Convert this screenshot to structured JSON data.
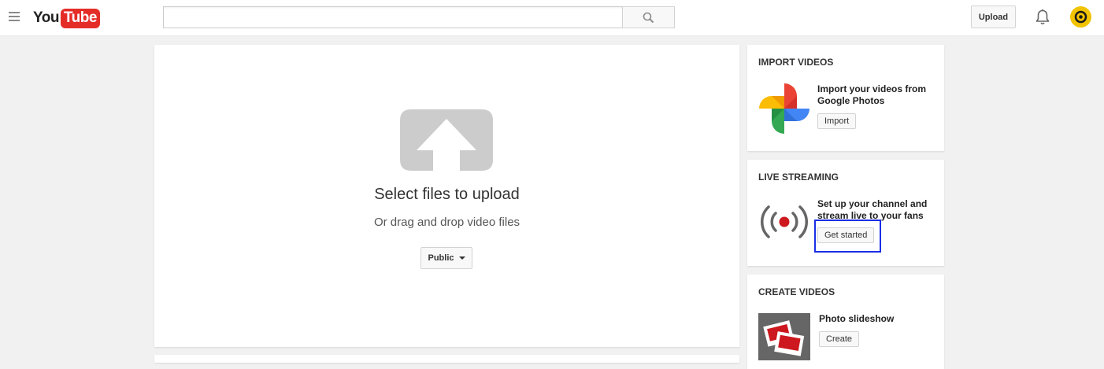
{
  "header": {
    "logo_you": "You",
    "logo_tube": "Tube",
    "search_value": "",
    "upload_label": "Upload"
  },
  "upload": {
    "title": "Select files to upload",
    "subtitle": "Or drag and drop video files",
    "privacy_label": "Public"
  },
  "sidebar": {
    "import": {
      "heading": "IMPORT VIDEOS",
      "text": "Import your videos from Google Photos",
      "button": "Import"
    },
    "live": {
      "heading": "LIVE STREAMING",
      "text": "Set up your channel and stream live to your fans",
      "button": "Get started"
    },
    "create": {
      "heading": "CREATE VIDEOS",
      "text": "Photo slideshow",
      "button": "Create"
    }
  },
  "colors": {
    "brand_red": "#e52d27",
    "avatar_yellow": "#f2c300",
    "focus_blue": "#1a2ee6",
    "upload_icon_gray": "#cccccc"
  }
}
